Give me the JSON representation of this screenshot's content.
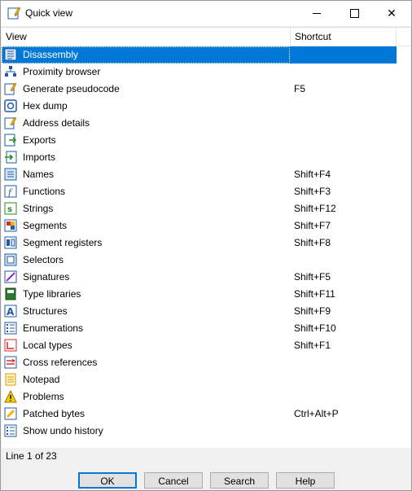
{
  "window": {
    "title": "Quick view"
  },
  "columns": {
    "view": "View",
    "shortcut": "Shortcut"
  },
  "rows": [
    {
      "label": "Disassembly",
      "shortcut": "",
      "icon": "disassembly-icon",
      "selected": true
    },
    {
      "label": "Proximity browser",
      "shortcut": "",
      "icon": "proximity-browser-icon"
    },
    {
      "label": "Generate pseudocode",
      "shortcut": "F5",
      "icon": "pseudocode-icon"
    },
    {
      "label": "Hex dump",
      "shortcut": "",
      "icon": "hex-dump-icon"
    },
    {
      "label": "Address details",
      "shortcut": "",
      "icon": "address-details-icon"
    },
    {
      "label": "Exports",
      "shortcut": "",
      "icon": "exports-icon"
    },
    {
      "label": "Imports",
      "shortcut": "",
      "icon": "imports-icon"
    },
    {
      "label": "Names",
      "shortcut": "Shift+F4",
      "icon": "names-icon"
    },
    {
      "label": "Functions",
      "shortcut": "Shift+F3",
      "icon": "functions-icon"
    },
    {
      "label": "Strings",
      "shortcut": "Shift+F12",
      "icon": "strings-icon"
    },
    {
      "label": "Segments",
      "shortcut": "Shift+F7",
      "icon": "segments-icon"
    },
    {
      "label": "Segment registers",
      "shortcut": "Shift+F8",
      "icon": "segment-registers-icon"
    },
    {
      "label": "Selectors",
      "shortcut": "",
      "icon": "selectors-icon"
    },
    {
      "label": "Signatures",
      "shortcut": "Shift+F5",
      "icon": "signatures-icon"
    },
    {
      "label": "Type libraries",
      "shortcut": "Shift+F11",
      "icon": "type-libraries-icon"
    },
    {
      "label": "Structures",
      "shortcut": "Shift+F9",
      "icon": "structures-icon"
    },
    {
      "label": "Enumerations",
      "shortcut": "Shift+F10",
      "icon": "enumerations-icon"
    },
    {
      "label": "Local types",
      "shortcut": "Shift+F1",
      "icon": "local-types-icon"
    },
    {
      "label": "Cross references",
      "shortcut": "",
      "icon": "cross-references-icon"
    },
    {
      "label": "Notepad",
      "shortcut": "",
      "icon": "notepad-icon"
    },
    {
      "label": "Problems",
      "shortcut": "",
      "icon": "problems-icon"
    },
    {
      "label": "Patched bytes",
      "shortcut": "Ctrl+Alt+P",
      "icon": "patched-bytes-icon"
    },
    {
      "label": "Show undo history",
      "shortcut": "",
      "icon": "undo-history-icon"
    }
  ],
  "status": {
    "text": "Line 1 of 23"
  },
  "buttons": {
    "ok": "OK",
    "cancel": "Cancel",
    "search": "Search",
    "help": "Help"
  },
  "colors": {
    "selection": "#0078d7",
    "button_default_border": "#0078d7"
  }
}
